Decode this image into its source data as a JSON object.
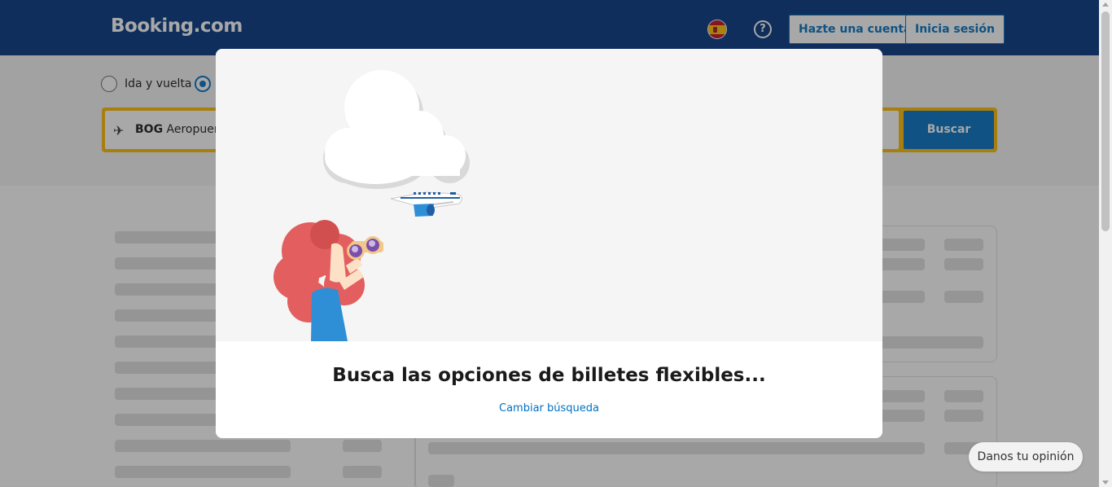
{
  "header": {
    "logo": "Booking.com",
    "language_flag": "spain-flag-icon",
    "help_icon": "help-icon",
    "create_account_label": "Hazte una cuenta",
    "login_label": "Inicia sesión"
  },
  "search": {
    "trip_types": [
      {
        "label": "Ida y vuelta",
        "selected": false
      },
      {
        "label": "",
        "selected": true
      }
    ],
    "origin_code": "BOG",
    "origin_name": "Aeropuerto",
    "search_button": "Buscar"
  },
  "modal": {
    "title": "Busca las opciones de billetes flexibles...",
    "change_search_link": "Cambiar búsqueda"
  },
  "feedback_button": "Danos tu opinión",
  "colors": {
    "brand_blue": "#003580",
    "action_blue": "#0071c2",
    "search_yellow": "#febb02"
  }
}
